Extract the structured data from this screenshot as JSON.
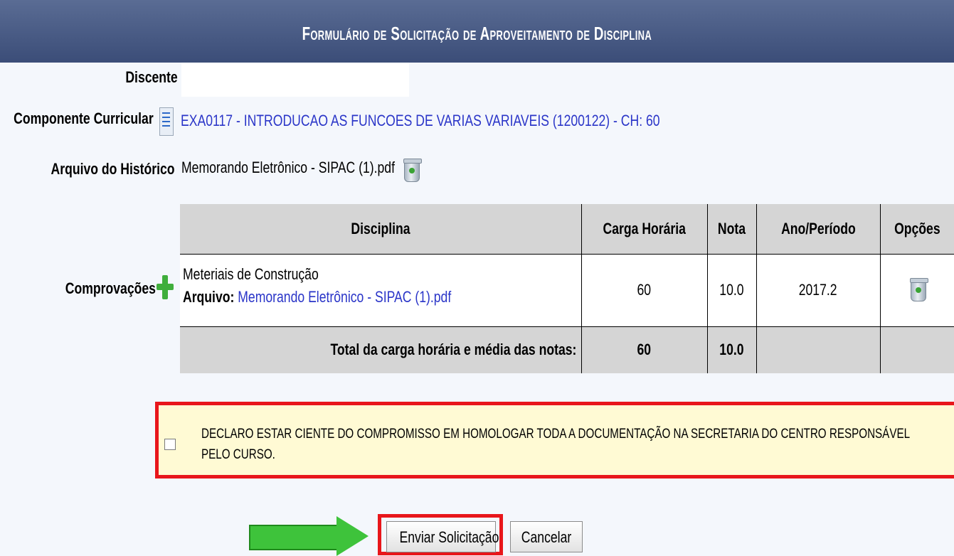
{
  "header": {
    "title": "Formulário de Solicitação de Aproveitamento de Disciplina"
  },
  "form": {
    "discente_label": "Discente",
    "discente_value": "",
    "componente_label": "Componente Curricular",
    "componente_value": "EXA0117 - INTRODUCAO AS FUNCOES DE VARIAS VARIAVEIS (1200122) - CH: 60",
    "arquivo_label": "Arquivo do Histórico",
    "arquivo_value": "Memorando Eletrônico - SIPAC (1).pdf",
    "comprovacoes_label": "Comprovações"
  },
  "table": {
    "headers": [
      "Disciplina",
      "Carga Horária",
      "Nota",
      "Ano/Período",
      "Opções"
    ],
    "row": {
      "disciplina": "Meteriais de Construção",
      "arquivo_label": "Arquivo:",
      "arquivo_link": "Memorando Eletrônico - SIPAC (1).pdf",
      "carga": "60",
      "nota": "10.0",
      "ano": "2017.2"
    },
    "total": {
      "label": "Total da carga horária e média das notas:",
      "carga": "60",
      "nota": "10.0"
    }
  },
  "declaration": {
    "text": "DECLARO ESTAR CIENTE DO COMPROMISSO EM HOMOLOGAR TODA A DOCUMENTAÇÃO NA SECRETARIA DO CENTRO RESPONSÁVEL PELO CURSO.",
    "checked": false
  },
  "buttons": {
    "submit": "Enviar Solicitação",
    "cancel": "Cancelar"
  },
  "colors": {
    "header": "#3b4d78",
    "highlight": "#e8161b",
    "arrow": "#3ec33b",
    "link": "#2a35c8"
  },
  "icons": [
    "document-icon",
    "trash-icon",
    "plus-icon",
    "arrow-right-icon"
  ]
}
